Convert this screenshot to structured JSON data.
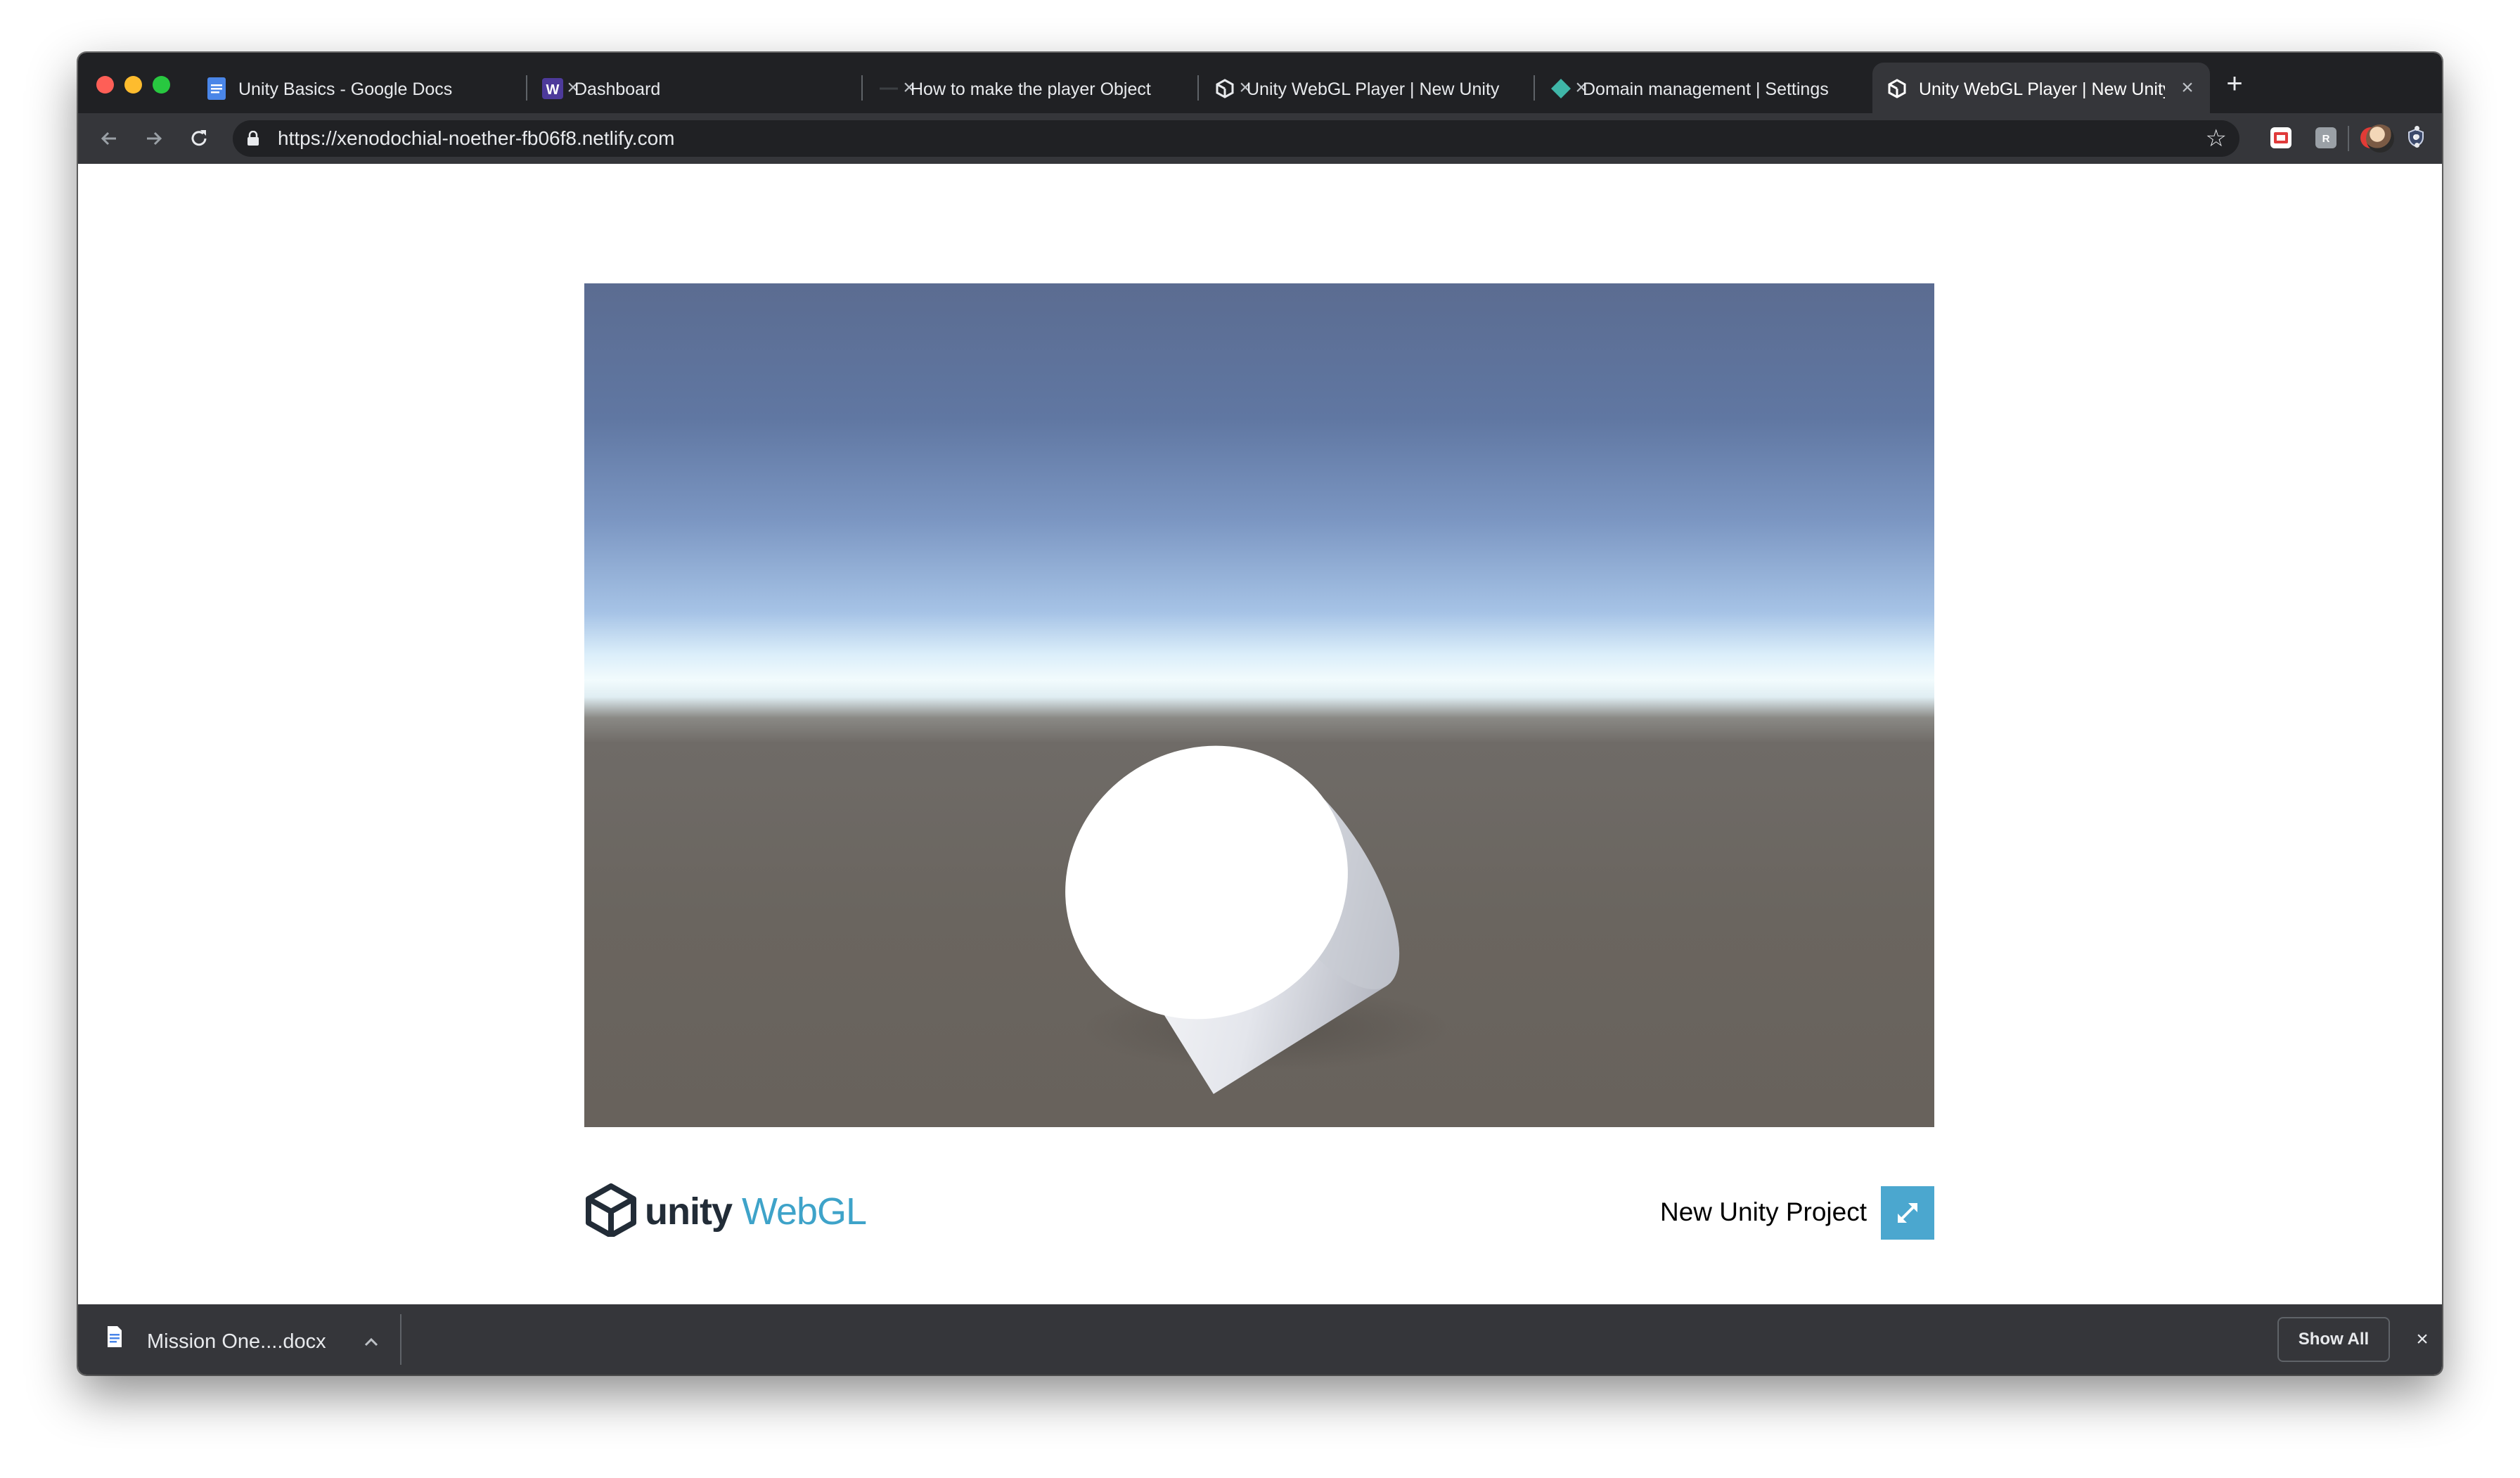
{
  "tabs": [
    {
      "title": "Unity Basics - Google Docs",
      "icon": "google-docs-icon"
    },
    {
      "title": "Dashboard",
      "icon": "webflow-icon"
    },
    {
      "title": "How to make the player Object",
      "icon": "page-icon"
    },
    {
      "title": "Unity WebGL Player | New Unity",
      "icon": "unity-icon"
    },
    {
      "title": "Domain management | Settings",
      "icon": "netlify-icon"
    },
    {
      "title": "Unity WebGL Player | New Unity",
      "icon": "unity-icon",
      "active": true
    }
  ],
  "toolbar": {
    "url": "https://xenodochial-noether-fb06f8.netlify.com"
  },
  "page": {
    "logo_unity": "unity",
    "logo_webgl": "WebGL",
    "project_title": "New Unity Project"
  },
  "downloads": {
    "file_name": "Mission One....docx",
    "show_all_label": "Show All"
  },
  "colors": {
    "browser_frame": "#202124",
    "toolbar": "#35363a",
    "unity_blue": "#4ba7cf",
    "unity_dark": "#222c37",
    "sky_top": "#5b6c91",
    "ground": "#6a655f"
  }
}
